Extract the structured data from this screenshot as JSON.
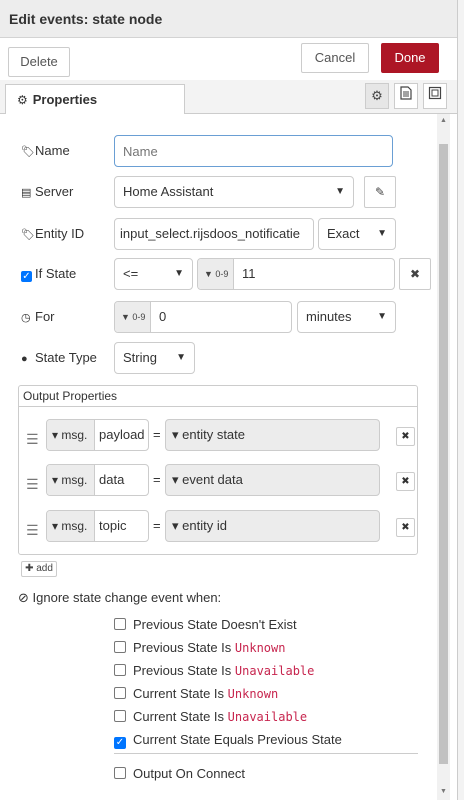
{
  "tray": {
    "title": "Edit events: state node"
  },
  "toolbar": {
    "delete_label": "Delete",
    "cancel_label": "Cancel",
    "done_label": "Done"
  },
  "tabs": {
    "properties_label": "Properties"
  },
  "form": {
    "name": {
      "label": "Name",
      "placeholder": "Name",
      "value": ""
    },
    "server": {
      "label": "Server",
      "value": "Home Assistant"
    },
    "entity_id": {
      "label": "Entity ID",
      "value": "input_select.rijsdoos_notificatie",
      "match": "Exact"
    },
    "if_state": {
      "label": "If State",
      "operator": "<=",
      "type_icon": "0-9",
      "value": "11"
    },
    "for": {
      "label": "For",
      "type_icon": "0-9",
      "value": "0",
      "unit": "minutes"
    },
    "state_type": {
      "label": "State Type",
      "value": "String"
    }
  },
  "output_properties": {
    "header": "Output Properties",
    "prefix": "msg.",
    "equals": "=",
    "rows": [
      {
        "property": "payload",
        "source": "entity state"
      },
      {
        "property": "data",
        "source": "event data"
      },
      {
        "property": "topic",
        "source": "entity id"
      }
    ],
    "add_label": "add"
  },
  "ignore": {
    "label": "Ignore state change event when:",
    "options": [
      {
        "text": "Previous State Doesn't Exist",
        "code": "",
        "checked": false
      },
      {
        "text": "Previous State Is ",
        "code": "Unknown",
        "checked": false
      },
      {
        "text": "Previous State Is ",
        "code": "Unavailable",
        "checked": false
      },
      {
        "text": "Current State Is ",
        "code": "Unknown",
        "checked": false
      },
      {
        "text": "Current State Is ",
        "code": "Unavailable",
        "checked": false
      },
      {
        "text": "Current State Equals Previous State",
        "code": "",
        "checked": true
      }
    ]
  },
  "output_on_connect": {
    "label": "Output On Connect",
    "checked": false
  },
  "colors": {
    "done": "#ad1625",
    "checkbox_checked": "#0075ff",
    "code": "#c7254e"
  }
}
